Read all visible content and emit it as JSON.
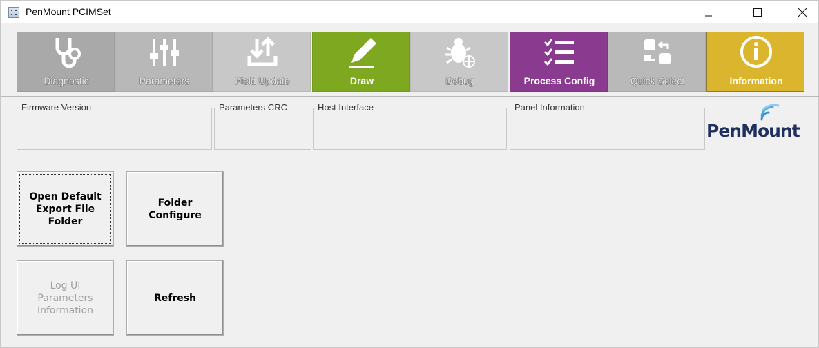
{
  "window": {
    "title": "PenMount PCIMSet",
    "controls": [
      "minimize",
      "maximize",
      "close"
    ]
  },
  "toolbar": {
    "items": [
      {
        "label": "Diagnostic",
        "icon": "stethoscope-icon",
        "color": "#a9a9a9",
        "state": "inactive"
      },
      {
        "label": "Parameters",
        "icon": "sliders-icon",
        "color": "#b8b8b8",
        "state": "inactive"
      },
      {
        "label": "Field Update",
        "icon": "upload-icon",
        "color": "#c8c8c8",
        "state": "inactive"
      },
      {
        "label": "Draw",
        "icon": "pencil-icon",
        "color": "#7ea81f",
        "state": "active"
      },
      {
        "label": "Debug",
        "icon": "bug-icon",
        "color": "#c8c8c8",
        "state": "inactive"
      },
      {
        "label": "Process Config",
        "icon": "checklist-icon",
        "color": "#8a3a8f",
        "state": "active"
      },
      {
        "label": "Quick Select",
        "icon": "swap-icon",
        "color": "#b9b9b9",
        "state": "inactive"
      },
      {
        "label": "Information",
        "icon": "info-icon",
        "color": "#dcb52e",
        "state": "active"
      }
    ]
  },
  "groups": {
    "firmware_version": "Firmware Version",
    "parameters_crc": "Parameters CRC",
    "host_interface": "Host Interface",
    "panel_information": "Panel Information"
  },
  "logo": {
    "text_pen": "Pen",
    "text_mount": "Mount"
  },
  "buttons": {
    "open_default": "Open Default\nExport File\nFolder",
    "folder_configure": "Folder\nConfigure",
    "log_ui": "Log UI\nParameters\nInformation",
    "refresh": "Refresh"
  }
}
